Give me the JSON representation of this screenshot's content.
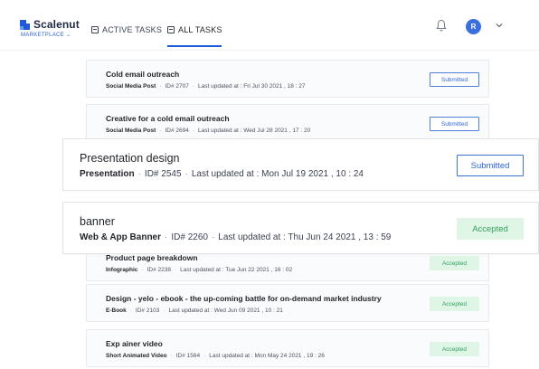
{
  "brand": {
    "name": "Scalenut",
    "sub": "MARKETPLACE"
  },
  "nav": {
    "active_tasks": "ACTIVE TASKS",
    "all_tasks": "ALL TASKS"
  },
  "user": {
    "initial": "R"
  },
  "tasks": [
    {
      "title": "Cold email outreach",
      "type": "Social Media Post",
      "id": "ID# 2707",
      "updated": "Last updated at : Fri Jul 30 2021 , 18 : 27",
      "status": "Submitted"
    },
    {
      "title": "Creative for a cold email outreach",
      "type": "Social Media Post",
      "id": "ID# 2694",
      "updated": "Last updated at : Wed Jul 28 2021 , 17 : 20",
      "status": "Submitted"
    },
    {
      "title": "Presentation design",
      "type": "Presentation",
      "id": "ID# 2545",
      "updated": "Last updated at : Mon Jul 19 2021 , 10 : 24",
      "status": "Submitted"
    },
    {
      "title": "banner",
      "type": "Web & App Banner",
      "id": "ID# 2260",
      "updated": "Last updated at : Thu Jun 24 2021 , 13 : 59",
      "status": "Accepted"
    },
    {
      "title": "Product page breakdown",
      "type": "Infographic",
      "id": "ID# 2238",
      "updated": "Last updated at : Tue Jun 22 2021 , 16 : 02",
      "status": "Accepted"
    },
    {
      "title": "Design - yelo - ebook - the up-coming battle for on-demand market industry",
      "type": "E-Book",
      "id": "ID# 2103",
      "updated": "Last updated at : Wed Jun 09 2021 , 10 : 21",
      "status": "Accepted"
    },
    {
      "title": "Exp ainer video",
      "type": "Short Animated Video",
      "id": "ID# 1564",
      "updated": "Last updated at : Mon May 24 2021 , 19 : 26",
      "status": "Accepted"
    }
  ],
  "colors": {
    "accent": "#1f5ad8",
    "submitted": "#2f64d6",
    "accepted_bg": "#dff5e6",
    "accepted_text": "#34a15d"
  }
}
